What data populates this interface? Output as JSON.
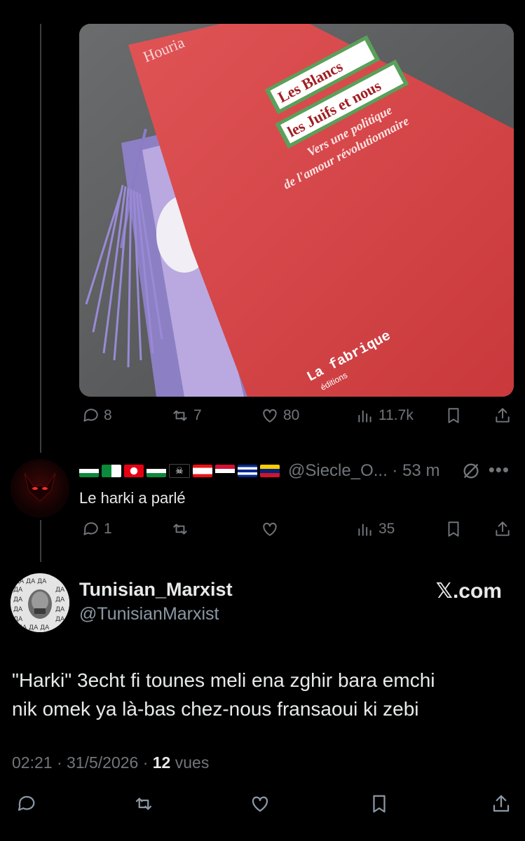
{
  "parent_post": {
    "image": {
      "description_icon": "book-photo",
      "cover_texts": {
        "author": "Houria",
        "title_line1": "Les Blancs",
        "title_line2": "les Juifs et nous",
        "subtitle_line1": "Vers une politique",
        "subtitle_line2": "de l'amour révolutionnaire",
        "publisher": "La fabrique",
        "publisher_sub": "éditions"
      }
    },
    "stats": {
      "replies": "8",
      "reposts": "7",
      "likes": "80",
      "views": "11.7k"
    }
  },
  "reply": {
    "flags": [
      "palestine",
      "algeria",
      "tunisia",
      "western-sahara",
      "pirate",
      "lebanon",
      "sudan",
      "cuba",
      "venezuela"
    ],
    "handle": "@Siecle_O... · 53 m",
    "text": "Le harki a parlé",
    "stats": {
      "replies": "1",
      "reposts": "",
      "likes": "",
      "views": "35"
    }
  },
  "main_post": {
    "display_name": "Tunisian_Marxist",
    "handle": "@TunisianMarxist",
    "brand": "𝕏.com",
    "text_line1": "\"Harki\" 3echt fi tounes meli ena zghir bara emchi",
    "text_line2": "nik omek ya là-bas chez-nous fransaoui ki zebi",
    "timestamp": "02:21 · 31/5/2026 · ",
    "views_count": "12",
    "views_label": " vues"
  },
  "colors": {
    "background": "#000000",
    "muted": "#71767b",
    "text": "#e7e9ea",
    "book_red": "#d9484b"
  }
}
